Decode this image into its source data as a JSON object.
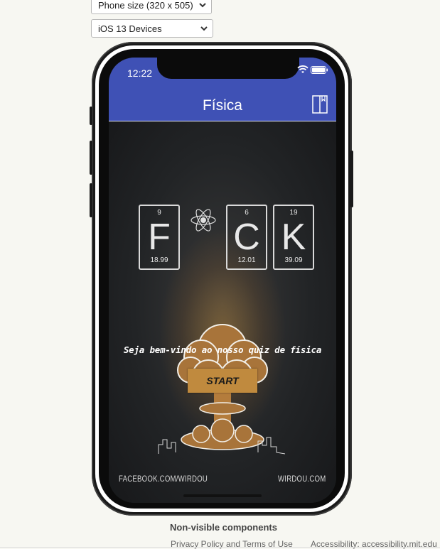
{
  "selectors": {
    "phone_size": "Phone size (320 x 505)",
    "os": "iOS 13 Devices"
  },
  "status_bar": {
    "time": "12:22"
  },
  "app_bar": {
    "title": "Física"
  },
  "elements": [
    {
      "number": "9",
      "symbol": "F",
      "mass": "18.99"
    },
    {
      "number": "6",
      "symbol": "C",
      "mass": "12.01"
    },
    {
      "number": "19",
      "symbol": "K",
      "mass": "39.09"
    }
  ],
  "main": {
    "welcome": "Seja bem-vindo ao nosso quiz de física",
    "start_label": "START"
  },
  "footer": {
    "left": "FACEBOOK.COM/WIRDOU",
    "right": "WIRDOU.COM"
  },
  "page_footer": {
    "non_visible": "Non-visible components",
    "privacy": "Privacy Policy and Terms of Use",
    "accessibility": "Accessibility: accessibility.mit.edu"
  },
  "colors": {
    "appbar": "#3f51b5",
    "start_button": "#c08a3e"
  },
  "icons": [
    "chevron-down-icon",
    "wifi-icon",
    "battery-icon",
    "book-icon",
    "atom-icon"
  ]
}
